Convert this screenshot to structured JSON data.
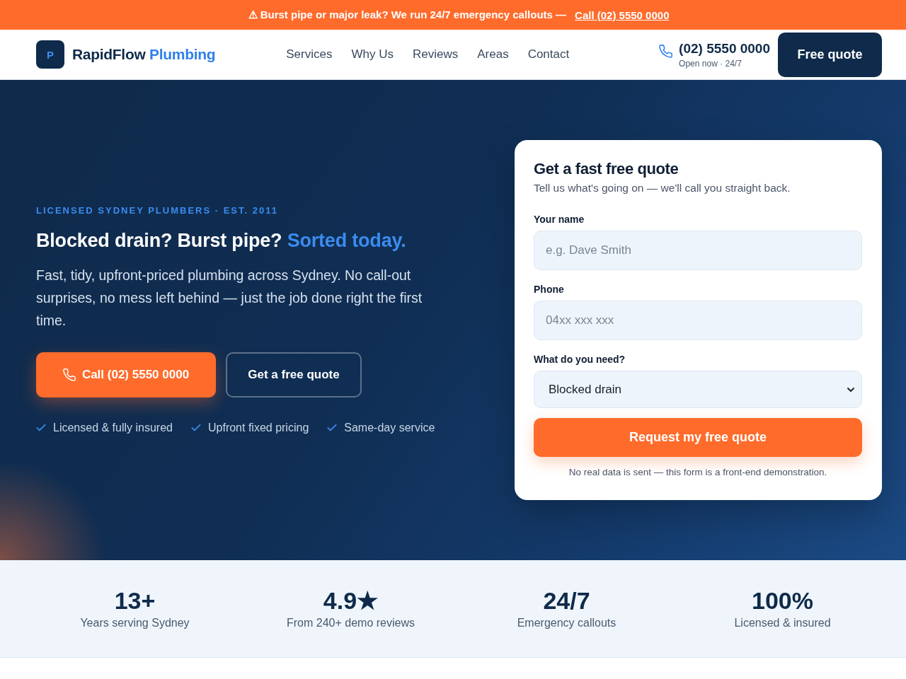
{
  "alert_bar": {
    "text": "⚠ Burst pipe or major leak? We run 24/7 emergency callouts —",
    "link": "Call (02) 5550 0000"
  },
  "header": {
    "logo": {
      "mark": "P",
      "name": "RapidFlow",
      "name_accent": "Plumbing"
    },
    "nav": [
      "Services",
      "Why Us",
      "Reviews",
      "Areas",
      "Contact"
    ],
    "phone": {
      "number": "(02) 5550 0000",
      "status": "Open now · 24/7"
    },
    "cta": "Free quote"
  },
  "hero": {
    "eyebrow": "LICENSED SYDNEY PLUMBERS · EST. 2011",
    "headline": "Blocked drain? Burst pipe?",
    "headline_accent": "Sorted today.",
    "body": "Fast, tidy, upfront-priced plumbing across Sydney. No call-out surprises, no mess left behind — just the job done right the first time.",
    "buttons": [
      {
        "kind": "call",
        "label": "Call (02) 5550 0000"
      },
      {
        "kind": "outline",
        "label": "Get a free quote"
      }
    ],
    "features": [
      "Licensed & fully insured",
      "Upfront fixed pricing",
      "Same-day service"
    ]
  },
  "quote_form": {
    "title": "Get a fast free quote",
    "subtitle": "Tell us what's going on — we'll call you straight back.",
    "fields": [
      {
        "kind": "text",
        "label": "Your name",
        "placeholder": "e.g. Dave Smith"
      },
      {
        "kind": "text",
        "label": "Phone",
        "placeholder": "04xx xxx xxx"
      },
      {
        "kind": "select",
        "label": "What do you need?",
        "value": "Blocked drain"
      }
    ],
    "submit": "Request my free quote",
    "note": "No real data is sent — this form is a front-end demonstration."
  },
  "stats": [
    {
      "value": "13+",
      "label": "Years serving Sydney"
    },
    {
      "value": "4.9★",
      "label": "From 240+ demo reviews"
    },
    {
      "value": "24/7",
      "label": "Emergency callouts"
    },
    {
      "value": "100%",
      "label": "Licensed & insured"
    }
  ]
}
